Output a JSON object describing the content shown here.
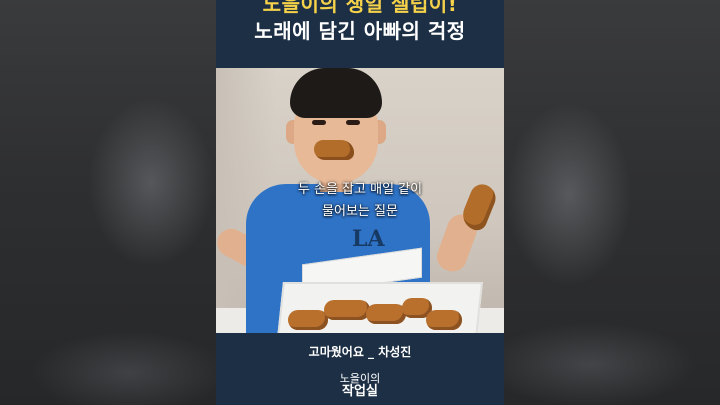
{
  "title": {
    "line1": "노을이의 생일 셀럽이!",
    "line2": "노래에 담긴 아빠의 걱정"
  },
  "subtitle": {
    "line1": "두 손을 잡고 매일 같이",
    "line2": "물어보는 질문"
  },
  "shirt_logo": "LA",
  "credit": "고마웠어요 _ 차성진",
  "brand": {
    "line1": "노을이의",
    "line2": "작업실"
  },
  "colors": {
    "frame_bg": "#1c2f44",
    "title_accent": "#f5d24a",
    "brand_accent": "#7bd26a"
  }
}
